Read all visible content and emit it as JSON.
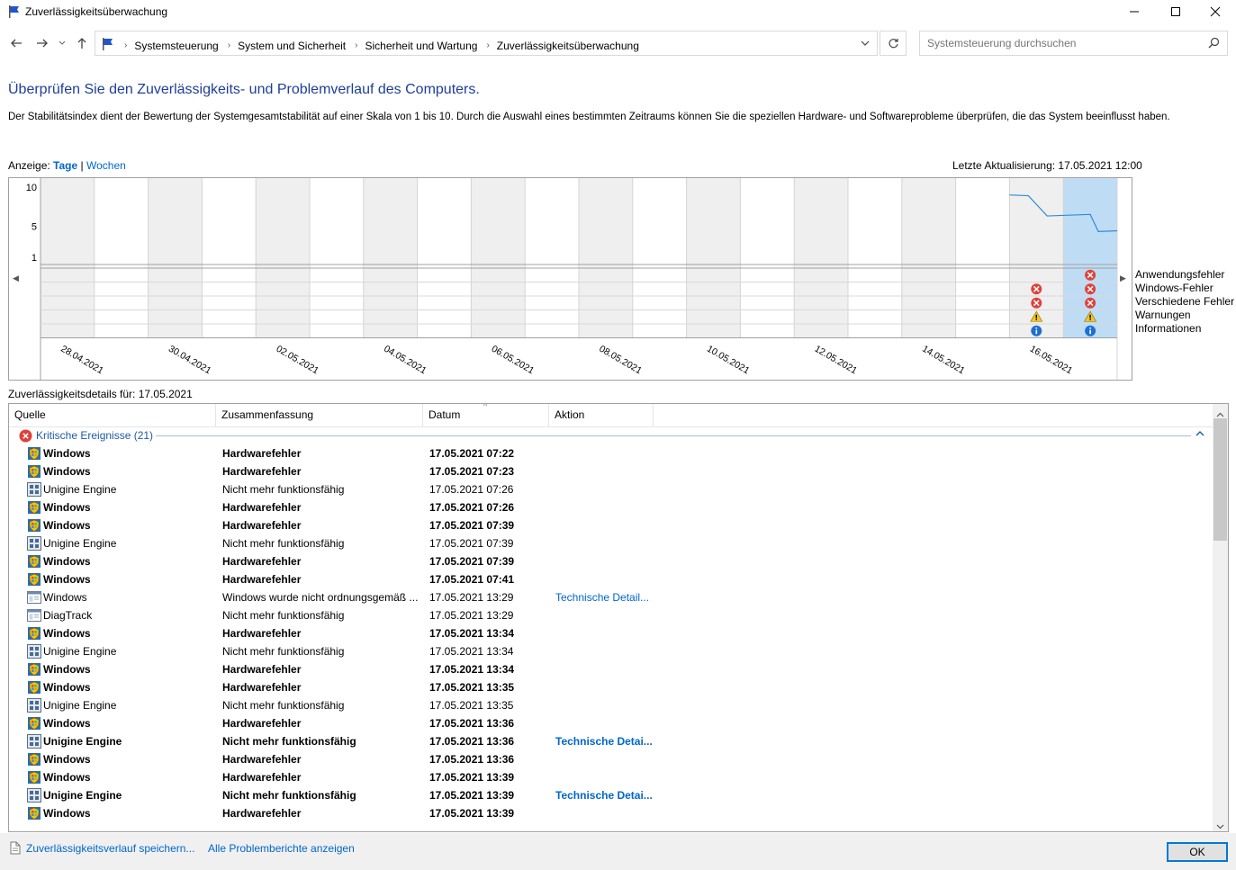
{
  "window": {
    "title": "Zuverlässigkeitsüberwachung",
    "icon": "flag-icon"
  },
  "addressbar": {
    "crumbs": [
      "Systemsteuerung",
      "System und Sicherheit",
      "Sicherheit und Wartung",
      "Zuverlässigkeitsüberwachung"
    ]
  },
  "search": {
    "placeholder": "Systemsteuerung durchsuchen"
  },
  "main": {
    "heading": "Überprüfen Sie den Zuverlässigkeits- und Problemverlauf des Computers.",
    "description": "Der Stabilitätsindex dient der Bewertung der Systemgesamtstabilität auf einer Skala von 1 bis 10. Durch die Auswahl eines bestimmten Zeitraums können Sie die speziellen Hardware- und Softwareprobleme überprüfen, die das System beeinflusst haben.",
    "view_label": "Anzeige:",
    "view_days": "Tage",
    "view_sep": "|",
    "view_weeks": "Wochen",
    "last_update": "Letzte Aktualisierung: 17.05.2021 12:00"
  },
  "chart_data": {
    "type": "line",
    "y_ticks": [
      "10",
      "5",
      "1"
    ],
    "ylim": [
      1,
      10
    ],
    "x_labels": [
      "28.04.2021",
      "30.04.2021",
      "02.05.2021",
      "04.05.2021",
      "06.05.2021",
      "08.05.2021",
      "10.05.2021",
      "12.05.2021",
      "14.05.2021",
      "16.05.2021"
    ],
    "day_count": 20,
    "selected_day_index": 19,
    "stability": [
      {
        "day": 18.0,
        "value": 9.0
      },
      {
        "day": 18.35,
        "value": 8.9
      },
      {
        "day": 18.7,
        "value": 6.3
      },
      {
        "day": 19.5,
        "value": 6.5
      },
      {
        "day": 19.65,
        "value": 4.3
      },
      {
        "day": 20.0,
        "value": 4.4
      }
    ],
    "categories": [
      "Anwendungsfehler",
      "Windows-Fehler",
      "Verschiedene Fehler",
      "Warnungen",
      "Informationen"
    ],
    "events": [
      {
        "day_index": 18,
        "icons": [
          "",
          "error",
          "error",
          "warning",
          "info"
        ]
      },
      {
        "day_index": 19,
        "icons": [
          "error",
          "error",
          "error",
          "warning",
          "info"
        ]
      }
    ]
  },
  "details": {
    "label": "Zuverlässigkeitsdetails für: 17.05.2021",
    "columns": [
      "Quelle",
      "Zusammenfassung",
      "Datum",
      "Aktion"
    ],
    "group": "Kritische Ereignisse (21)",
    "rows": [
      {
        "icon": "windows-shield-icon",
        "source": "Windows",
        "summary": "Hardwarefehler",
        "date": "17.05.2021 07:22",
        "action": "",
        "bold": true
      },
      {
        "icon": "windows-shield-icon",
        "source": "Windows",
        "summary": "Hardwarefehler",
        "date": "17.05.2021 07:23",
        "action": "",
        "bold": true
      },
      {
        "icon": "app-grid-icon",
        "source": "Unigine Engine",
        "summary": "Nicht mehr funktionsfähig",
        "date": "17.05.2021 07:26",
        "action": "",
        "bold": false
      },
      {
        "icon": "windows-shield-icon",
        "source": "Windows",
        "summary": "Hardwarefehler",
        "date": "17.05.2021 07:26",
        "action": "",
        "bold": true
      },
      {
        "icon": "windows-shield-icon",
        "source": "Windows",
        "summary": "Hardwarefehler",
        "date": "17.05.2021 07:39",
        "action": "",
        "bold": true
      },
      {
        "icon": "app-grid-icon",
        "source": "Unigine Engine",
        "summary": "Nicht mehr funktionsfähig",
        "date": "17.05.2021 07:39",
        "action": "",
        "bold": false
      },
      {
        "icon": "windows-shield-icon",
        "source": "Windows",
        "summary": "Hardwarefehler",
        "date": "17.05.2021 07:39",
        "action": "",
        "bold": true
      },
      {
        "icon": "windows-shield-icon",
        "source": "Windows",
        "summary": "Hardwarefehler",
        "date": "17.05.2021 07:41",
        "action": "",
        "bold": true
      },
      {
        "icon": "window-app-icon",
        "source": "Windows",
        "summary": "Windows wurde nicht ordnungsgemäß ...",
        "date": "17.05.2021 13:29",
        "action": "Technische Detail...",
        "bold": false
      },
      {
        "icon": "window-app-icon",
        "source": "DiagTrack",
        "summary": "Nicht mehr funktionsfähig",
        "date": "17.05.2021 13:29",
        "action": "",
        "bold": false
      },
      {
        "icon": "windows-shield-icon",
        "source": "Windows",
        "summary": "Hardwarefehler",
        "date": "17.05.2021 13:34",
        "action": "",
        "bold": true
      },
      {
        "icon": "app-grid-icon",
        "source": "Unigine Engine",
        "summary": "Nicht mehr funktionsfähig",
        "date": "17.05.2021 13:34",
        "action": "",
        "bold": false
      },
      {
        "icon": "windows-shield-icon",
        "source": "Windows",
        "summary": "Hardwarefehler",
        "date": "17.05.2021 13:34",
        "action": "",
        "bold": true
      },
      {
        "icon": "windows-shield-icon",
        "source": "Windows",
        "summary": "Hardwarefehler",
        "date": "17.05.2021 13:35",
        "action": "",
        "bold": true
      },
      {
        "icon": "app-grid-icon",
        "source": "Unigine Engine",
        "summary": "Nicht mehr funktionsfähig",
        "date": "17.05.2021 13:35",
        "action": "",
        "bold": false
      },
      {
        "icon": "windows-shield-icon",
        "source": "Windows",
        "summary": "Hardwarefehler",
        "date": "17.05.2021 13:36",
        "action": "",
        "bold": true
      },
      {
        "icon": "app-grid-icon",
        "source": "Unigine Engine",
        "summary": "Nicht mehr funktionsfähig",
        "date": "17.05.2021 13:36",
        "action": "Technische Detai...",
        "bold": true
      },
      {
        "icon": "windows-shield-icon",
        "source": "Windows",
        "summary": "Hardwarefehler",
        "date": "17.05.2021 13:36",
        "action": "",
        "bold": true
      },
      {
        "icon": "windows-shield-icon",
        "source": "Windows",
        "summary": "Hardwarefehler",
        "date": "17.05.2021 13:39",
        "action": "",
        "bold": true
      },
      {
        "icon": "app-grid-icon",
        "source": "Unigine Engine",
        "summary": "Nicht mehr funktionsfähig",
        "date": "17.05.2021 13:39",
        "action": "Technische Detai...",
        "bold": true
      },
      {
        "icon": "windows-shield-icon",
        "source": "Windows",
        "summary": "Hardwarefehler",
        "date": "17.05.2021 13:39",
        "action": "",
        "bold": true
      }
    ]
  },
  "footer": {
    "save_link": "Zuverlässigkeitsverlauf speichern...",
    "reports_link": "Alle Problemberichte anzeigen",
    "ok_label": "OK"
  },
  "colors": {
    "accent": "#1e3e9a",
    "link": "#0066cc",
    "error": "#e0413a",
    "warning": "#f5c518",
    "info": "#1e6fd0",
    "selected": "#bfdcf5",
    "line": "#2f8ad8"
  }
}
